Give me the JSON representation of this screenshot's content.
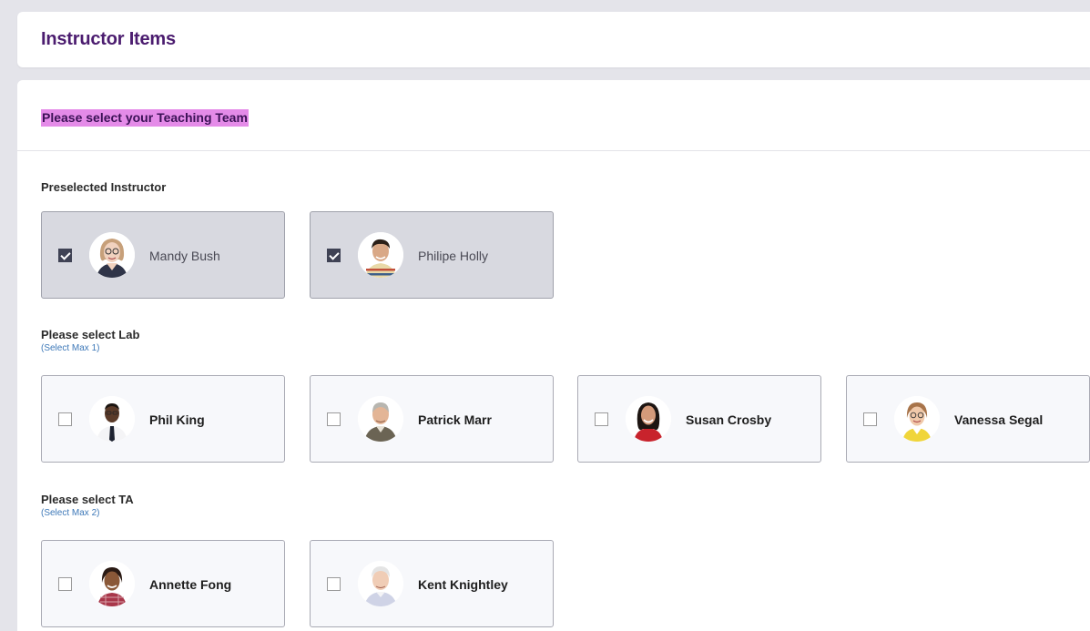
{
  "header": {
    "title": "Instructor Items"
  },
  "main": {
    "team_heading": "Please select your Teaching Team",
    "preselected": {
      "label": "Preselected Instructor",
      "people": [
        {
          "name": "Mandy Bush",
          "checked": true,
          "avatar": "avatar-woman-glasses"
        },
        {
          "name": "Philipe Holly",
          "checked": true,
          "avatar": "avatar-man-striped-shirt"
        }
      ]
    },
    "lab": {
      "label": "Please select Lab",
      "sub": "(Select Max 1)",
      "people": [
        {
          "name": "Phil King",
          "checked": false,
          "avatar": "avatar-man-tie"
        },
        {
          "name": "Patrick Marr",
          "checked": false,
          "avatar": "avatar-man-gray-hair"
        },
        {
          "name": "Susan Crosby",
          "checked": false,
          "avatar": "avatar-woman-red-top"
        },
        {
          "name": "Vanessa Segal",
          "checked": false,
          "avatar": "avatar-woman-yellow-top"
        }
      ]
    },
    "ta": {
      "label": "Please select TA",
      "sub": "(Select Max 2)",
      "people": [
        {
          "name": "Annette Fong",
          "checked": false,
          "avatar": "avatar-woman-plaid-shirt"
        },
        {
          "name": "Kent Knightley",
          "checked": false,
          "avatar": "avatar-man-white-hair"
        }
      ]
    }
  },
  "colors": {
    "title": "#4b1c6f",
    "highlight": "#e48be8",
    "selected_card": "#d8d9e0",
    "unselected_card": "#f7f8fb",
    "sub_label": "#3d78b8"
  }
}
